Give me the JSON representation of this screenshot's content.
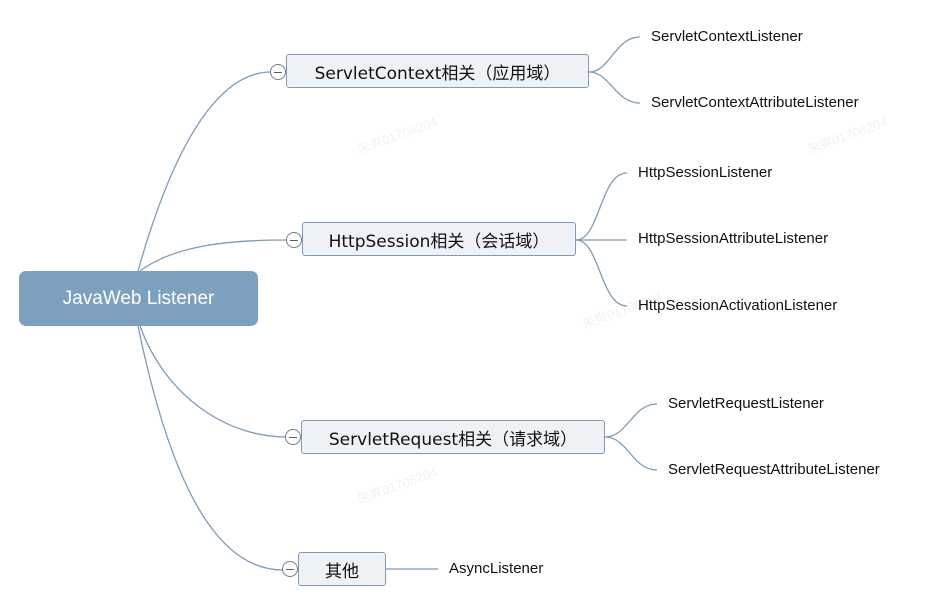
{
  "root": {
    "label": "JavaWeb Listener"
  },
  "branches": [
    {
      "label": "ServletContext相关（应用域）",
      "children": [
        "ServletContextListener",
        "ServletContextAttributeListener"
      ]
    },
    {
      "label": "HttpSession相关（会话域）",
      "children": [
        "HttpSessionListener",
        "HttpSessionAttributeListener",
        "HttpSessionActivationListener"
      ]
    },
    {
      "label": "ServletRequest相关（请求域）",
      "children": [
        "ServletRequestListener",
        "ServletRequestAttributeListener"
      ]
    },
    {
      "label": "其他",
      "children": [
        "AsyncListener"
      ]
    }
  ],
  "watermark": "朱爽01708204",
  "colors": {
    "root_fill": "#7da0bf",
    "branch_fill": "#eef2f6",
    "connector": "#7f9bb5"
  },
  "icons": {
    "collapse_toggle": "minus-circle-icon"
  }
}
